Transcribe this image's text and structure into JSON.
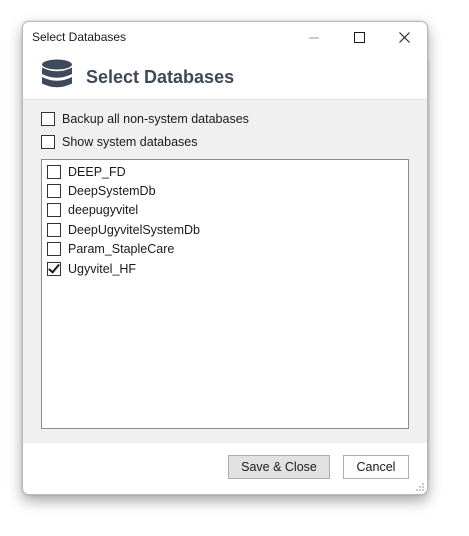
{
  "window": {
    "title": "Select Databases"
  },
  "titlebar_buttons": {
    "minimize": "minimize-icon",
    "maximize": "maximize-icon",
    "close": "close-icon"
  },
  "header": {
    "icon": "database-icon",
    "title": "Select Databases"
  },
  "options": {
    "backup_all": {
      "label": "Backup all non-system databases",
      "checked": false
    },
    "show_system": {
      "label": "Show system databases",
      "checked": false
    }
  },
  "databases": [
    {
      "name": "DEEP_FD",
      "checked": false
    },
    {
      "name": "DeepSystemDb",
      "checked": false
    },
    {
      "name": "deepugyvitel",
      "checked": false
    },
    {
      "name": "DeepUgyvitelSystemDb",
      "checked": false
    },
    {
      "name": "Param_StapleCare",
      "checked": false
    },
    {
      "name": "Ugyvitel_HF",
      "checked": true
    }
  ],
  "footer": {
    "save_label": "Save & Close",
    "cancel_label": "Cancel"
  },
  "colors": {
    "header_title": "#3e4a5a",
    "content_bg": "#f0f0f0",
    "button_bg": "#e1e1e1"
  }
}
